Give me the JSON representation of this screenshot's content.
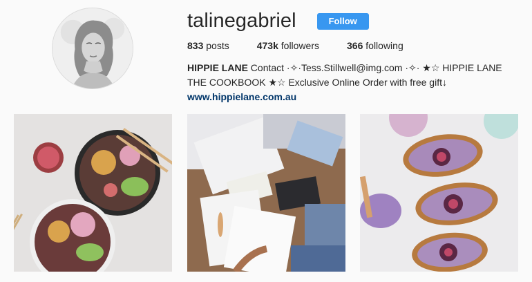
{
  "profile": {
    "username": "talinegabriel",
    "follow_label": "Follow",
    "stats": {
      "posts_count": "833",
      "posts_label": "posts",
      "followers_count": "473k",
      "followers_label": "followers",
      "following_count": "366",
      "following_label": "following"
    },
    "bio": {
      "name": "HIPPIE LANE",
      "text": "Contact ·✧·Tess.Stillwell@img.com ·✧· ★☆ HIPPIE LANE THE COOKBOOK ★☆ Exclusive Online Order with free gift↓",
      "link": "www.hippielane.com.au"
    }
  },
  "icons": {
    "avatar": "profile-photo",
    "posts": [
      "food-bowls-photo",
      "cookbook-flatlay-photo",
      "fig-toast-photo"
    ]
  },
  "colors": {
    "follow_button": "#3897f0",
    "link": "#003569",
    "background": "#fafafa"
  }
}
